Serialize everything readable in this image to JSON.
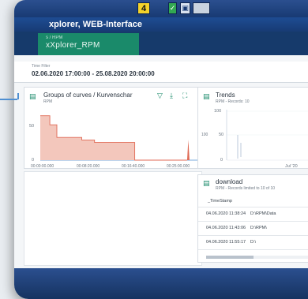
{
  "toolbar": {
    "number_badge": "4",
    "checkbox_glyph": "✓",
    "save_glyph": "▣"
  },
  "window": {
    "title": "xplorer, WEB-Interface"
  },
  "tab": {
    "small_caption": "s / RPM",
    "label": "xXplorer_RPM"
  },
  "filter": {
    "caption": "Time Filter",
    "value": "02.06.2020 17:00:00 - 25.08.2020 20:00:00"
  },
  "curves_panel": {
    "title": "Groups of curves / Kurvenschar",
    "subtitle": "RPM",
    "y_ticks": [
      "50",
      "0"
    ],
    "x_ticks": [
      "00:00:00.000",
      "00:08:20.000",
      "00:16:40.000",
      "00:25:00.000"
    ],
    "colors": {
      "line": "#e06a55",
      "fill": "#f3c7bc"
    }
  },
  "trends_panel": {
    "title": "Trends",
    "subtitle": "RPM - Records: 10",
    "y_ticks": [
      "100",
      "50",
      "0"
    ],
    "y_axis_label": "100",
    "x_tick": "Jul '20"
  },
  "download_panel": {
    "title": "download",
    "subtitle": "RPM - Records limited to 10 of 10",
    "column_header": "_TimeStamp",
    "rows": [
      {
        "timestamp": "04.06.2020 11:38:24",
        "path": "D:\\RPM\\Data"
      },
      {
        "timestamp": "04.06.2020 11:43:06",
        "path": "D:\\RPM\\"
      },
      {
        "timestamp": "04.06.2020 11:55:17",
        "path": "D:\\"
      }
    ]
  },
  "chart_data": {
    "type": "area",
    "title": "Groups of curves / Kurvenschar",
    "xlabel": "",
    "ylabel": "",
    "x_ticks": [
      "00:00:00.000",
      "00:08:20.000",
      "00:16:40.000",
      "00:25:00.000"
    ],
    "ylim": [
      0,
      100
    ],
    "series": [
      {
        "values": [
          [
            0,
            88
          ],
          [
            1.5,
            88
          ],
          [
            1.5,
            70
          ],
          [
            2.6,
            70
          ],
          [
            2.6,
            45
          ],
          [
            6.5,
            45
          ],
          [
            6.5,
            40
          ],
          [
            8.5,
            40
          ],
          [
            8.5,
            35
          ],
          [
            14.8,
            35
          ],
          [
            14.8,
            0
          ],
          [
            23,
            0
          ]
        ]
      }
    ],
    "spike": {
      "x": 23.2,
      "y": 40
    }
  }
}
